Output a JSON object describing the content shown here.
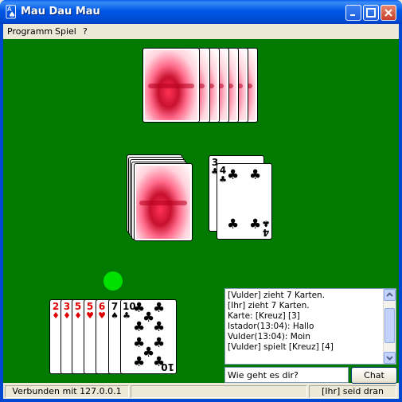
{
  "window": {
    "title": "Mau Dau Mau",
    "app_icon": "cards-icon"
  },
  "menu": {
    "items": [
      "Programm",
      "Spiel",
      "?"
    ]
  },
  "opponent": {
    "card_count": 7
  },
  "stock": {
    "card_count": 5
  },
  "discard": {
    "under": {
      "rank": "3",
      "suit": "♣"
    },
    "top": {
      "rank": "4",
      "suit": "♣"
    }
  },
  "hand": {
    "cards": [
      {
        "rank": "2",
        "suit": "♦",
        "color": "red"
      },
      {
        "rank": "3",
        "suit": "♦",
        "color": "red"
      },
      {
        "rank": "5",
        "suit": "♦",
        "color": "red"
      },
      {
        "rank": "5",
        "suit": "♥",
        "color": "red"
      },
      {
        "rank": "6",
        "suit": "♥",
        "color": "red"
      },
      {
        "rank": "7",
        "suit": "♠",
        "color": "black"
      },
      {
        "rank": "10",
        "suit": "♣",
        "color": "black"
      }
    ]
  },
  "turn_indicator_color": "#00e000",
  "chat": {
    "lines": [
      "[Vulder] zieht 7 Karten.",
      "[Ihr] zieht 7 Karten.",
      "Karte: [Kreuz] [3]",
      "Istador(13:04): Hallo",
      "Vulder(13:04): Moin",
      "[Vulder] spielt [Kreuz] [4]"
    ],
    "input_value": "Wie geht es dir?",
    "send_label": "Chat"
  },
  "status": {
    "connection": "Verbunden mit 127.0.0.1",
    "turn": "[Ihr] seid dran"
  },
  "colors": {
    "table": "#007a00",
    "titlebar": "#0058e6"
  }
}
